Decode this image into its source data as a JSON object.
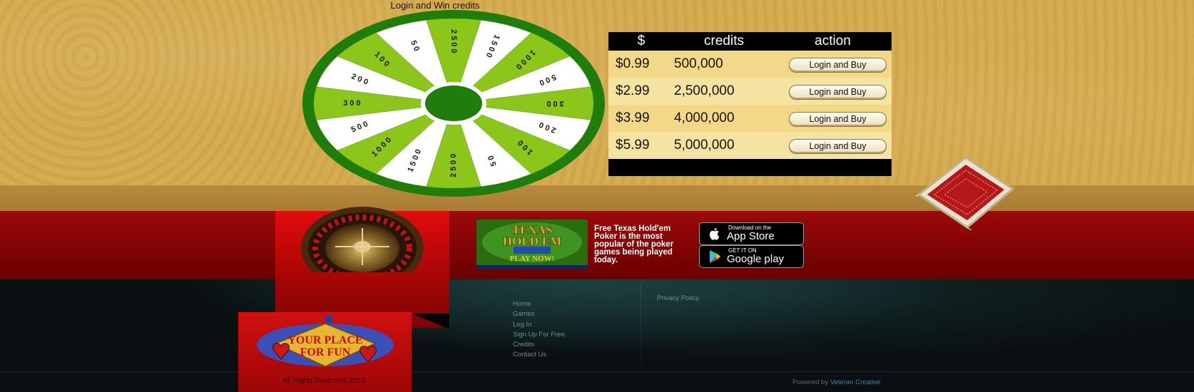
{
  "wheel": {
    "title": "Login and Win credits",
    "segments": [
      "2500",
      "1500",
      "1000",
      "500",
      "300",
      "200",
      "100",
      "50",
      "2500",
      "1500",
      "1000",
      "500",
      "300",
      "200",
      "100",
      "50"
    ]
  },
  "credits_table": {
    "headers": [
      "$",
      "credits",
      "action"
    ],
    "rows": [
      {
        "price": "$0.99",
        "credits": "500,000",
        "action": "Login and Buy"
      },
      {
        "price": "$2.99",
        "credits": "2,500,000",
        "action": "Login and Buy"
      },
      {
        "price": "$3.99",
        "credits": "4,000,000",
        "action": "Login and Buy"
      },
      {
        "price": "$5.99",
        "credits": "5,000,000",
        "action": "Login and Buy"
      }
    ]
  },
  "poker_banner": {
    "title_line1": "TEXAS",
    "title_line2": "HOLD'EM",
    "cta": "PLAY NOW!"
  },
  "poker_text": "Free Texas Hold'em Poker is the most popular of the poker games being played today.",
  "app_store": {
    "small": "Download on the",
    "big": "App Store"
  },
  "google_play": {
    "small": "GET IT ON",
    "big": "Google play"
  },
  "promo": {
    "line1": "YOUR PLACE",
    "line2": "FOR FUN"
  },
  "copyright": "All Rights Reserved. 2016.",
  "footer_nav": [
    "Home",
    "Games",
    "Log In",
    "Sign Up For Free",
    "Credits",
    "Contact Us"
  ],
  "privacy_link": "Privacy Policy",
  "powered_by": {
    "prefix": "Powered by",
    "link": "Veteran Creative"
  },
  "colors": {
    "wheel_green": "#1f7d0b",
    "wheel_light_green": "#8cc61a",
    "table_header": "#000000",
    "red_band": "#8a0404",
    "gold_background": "#d3a94e"
  },
  "icons": [
    "apple-icon",
    "google-play-icon",
    "roulette-wheel-icon",
    "diamond-card-icon",
    "dice-icon"
  ]
}
